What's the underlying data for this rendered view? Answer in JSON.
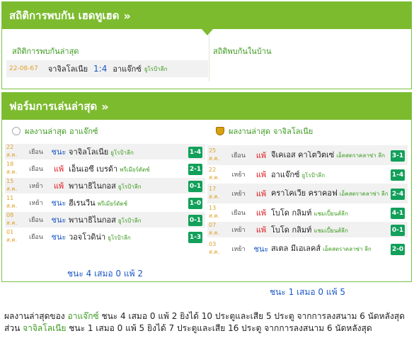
{
  "h2h": {
    "title": "สถิติการพบกัน เฮดทูเฮด",
    "chevron": "»",
    "left_title": "สถิติการพบกันล่าสุด",
    "right_title": "สถิติพบกันในบ้าน",
    "match": {
      "date": "22-08-67",
      "home": "จาจิลโลเนีย",
      "score": "1:4",
      "away": "อาแจ๊กซ์",
      "league": "ยูโรป้าลีก"
    }
  },
  "form": {
    "title": "ฟอร์มการเล่นล่าสุด",
    "chevron": "»",
    "left": {
      "title_prefix": "ผลงานล่าสุด",
      "team": "อาแจ๊กซ์",
      "rows": [
        {
          "date": "22 ส.ค.",
          "venue": "เยือน",
          "result": "ชนะ",
          "opponent": "จาจิลโลเนีย",
          "league": "ยูโรป้าลีก",
          "score": "1-4"
        },
        {
          "date": "18 ส.ค.",
          "venue": "เยือน",
          "result": "แพ้",
          "opponent": "เอ็นเอซี เบรด้า",
          "league": "พรีเมียร์ดัตช์",
          "score": "2-1"
        },
        {
          "date": "15 ส.ค.",
          "venue": "เหย้า",
          "result": "แพ้",
          "opponent": "พานาธิไนกอส",
          "league": "ยูโรป้าลีก",
          "score": "0-1"
        },
        {
          "date": "11 ส.ค.",
          "venue": "เหย้า",
          "result": "ชนะ",
          "opponent": "ฮีเรนวีน",
          "league": "พรีเมียร์ดัตช์",
          "score": "1-0"
        },
        {
          "date": "08 ส.ค.",
          "venue": "เยือน",
          "result": "ชนะ",
          "opponent": "พานาธิไนกอส",
          "league": "ยูโรป้าลีก",
          "score": "0-1"
        },
        {
          "date": "01 ส.ค.",
          "venue": "เยือน",
          "result": "ชนะ",
          "opponent": "วอจโวดิน่า",
          "league": "ยูโรป้าลีก",
          "score": "1-3"
        }
      ],
      "summary": "ชนะ 4 เสมอ 0 แพ้ 2"
    },
    "right": {
      "title_prefix": "ผลงานล่าสุด",
      "team": "จาจิลโลเนีย",
      "rows": [
        {
          "date": "25 ส.ค.",
          "venue": "เยือน",
          "result": "แพ้",
          "opponent": "จีเคเอส คาโตวิตเซ่",
          "league": "เอ็คสตราคลาซ่า ลีก",
          "score": "3-1"
        },
        {
          "date": "22 ส.ค.",
          "venue": "เหย้า",
          "result": "แพ้",
          "opponent": "อาแจ๊กซ์",
          "league": "ยูโรป้าลีก",
          "score": "1-4"
        },
        {
          "date": "17 ส.ค.",
          "venue": "เหย้า",
          "result": "แพ้",
          "opponent": "คราโคเวีย คราคอฟ",
          "league": "เอ็คสตราคลาซ่า ลีก",
          "score": "2-4"
        },
        {
          "date": "13 ส.ค.",
          "venue": "เยือน",
          "result": "แพ้",
          "opponent": "โบโด กลิมท์",
          "league": "แชมเปี้ยนส์ลีก",
          "score": "4-1"
        },
        {
          "date": "07 ส.ค.",
          "venue": "เหย้า",
          "result": "แพ้",
          "opponent": "โบโด กลิมท์",
          "league": "แชมเปี้ยนส์ลีก",
          "score": "0-1"
        },
        {
          "date": "03 ส.ค.",
          "venue": "เหย้า",
          "result": "ชนะ",
          "opponent": "สเตล มีเอเลคส์",
          "league": "เอ็คสตราคลาซ่า ลีก",
          "score": "2-0"
        }
      ],
      "summary": "ชนะ 1 เสมอ 0 แพ้ 5"
    }
  },
  "footnote": {
    "line1_prefix": "ผลงานล่าสุดของ",
    "line1_team": "อาแจ๊กซ์",
    "line1_rest": "ชนะ 4 เสมอ 0 แพ้ 2 ยิงได้ 10 ประตูและเสีย 5 ประตู จากการลงสนาม 6 นัดหลังสุด",
    "line2_prefix": "ส่วน",
    "line2_team": "จาจิลโลเนีย",
    "line2_rest": "ชนะ 1 เสมอ 0 แพ้ 5 ยิงได้ 7 ประตูและเสีย 16 ประตู จากการลงสนาม 6 นัดหลังสุด"
  },
  "colors": {
    "header_green": "#7cbb2e",
    "link_green": "#3c9a1e",
    "win_blue": "#1a57c7",
    "lose_red": "#e0151b",
    "badge_green": "#12a05a",
    "date_orange": "#e0a02a"
  }
}
